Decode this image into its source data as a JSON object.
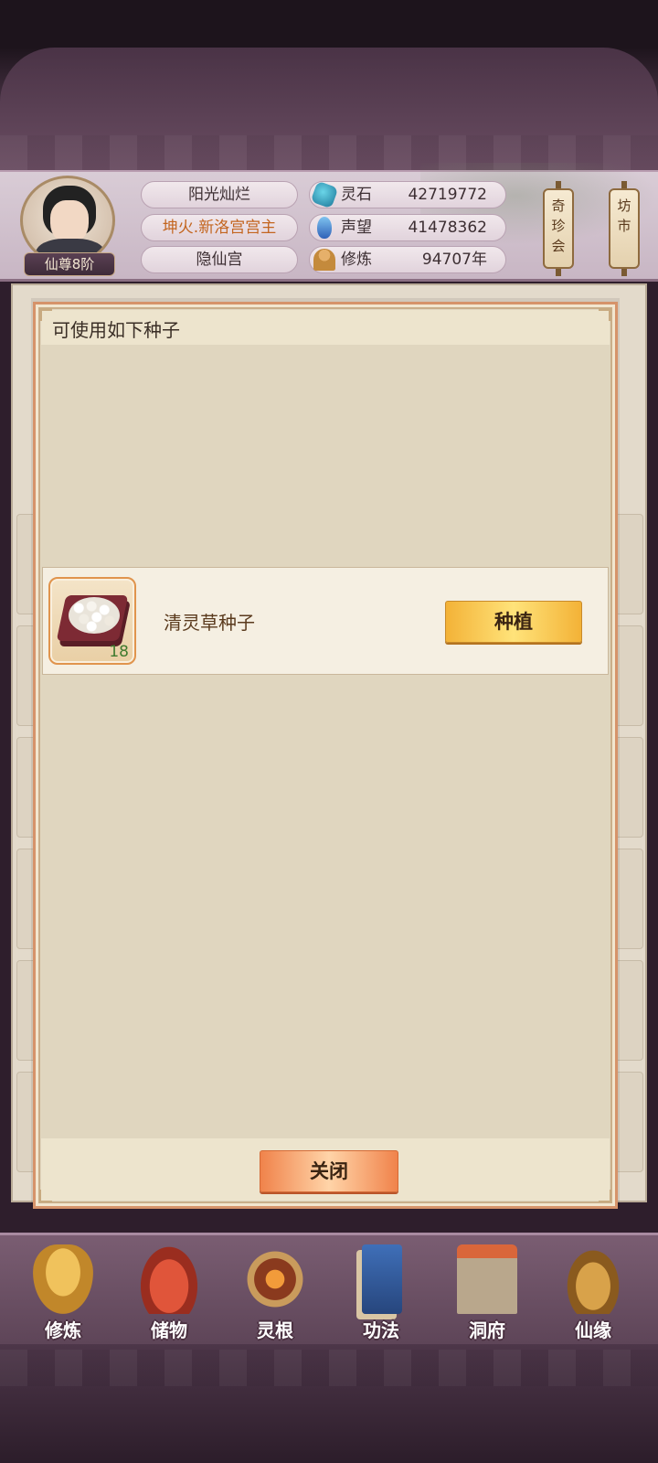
{
  "player": {
    "rank": "仙尊8阶",
    "name": "阳光灿烂",
    "title": "坤火.新洛宫宫主",
    "sect": "隐仙宫"
  },
  "stats": [
    {
      "icon": "spirit-stone-icon",
      "label": "灵石",
      "value": "42719772"
    },
    {
      "icon": "reputation-icon",
      "label": "声望",
      "value": "41478362"
    },
    {
      "icon": "cultivation-icon",
      "label": "修炼",
      "value": "94707年"
    }
  ],
  "side_buttons": {
    "qizhenhui": "奇珍会",
    "fangshi": "坊市"
  },
  "modal": {
    "title": "可使用如下种子",
    "items": [
      {
        "icon": "seed-tray-icon",
        "name": "清灵草种子",
        "count": "18",
        "action": "种植"
      }
    ],
    "close_label": "关闭"
  },
  "bottom_nav": [
    {
      "icon": "cultivate-icon",
      "label": "修炼"
    },
    {
      "icon": "storage-bag-icon",
      "label": "储物"
    },
    {
      "icon": "spirit-root-icon",
      "label": "灵根"
    },
    {
      "icon": "technique-book-icon",
      "label": "功法"
    },
    {
      "icon": "cave-mansion-icon",
      "label": "洞府"
    },
    {
      "icon": "immortal-fate-icon",
      "label": "仙缘"
    }
  ],
  "colors": {
    "accent_orange": "#c3651f",
    "plant_button": "#f3b237",
    "close_button": "#f0834b",
    "seed_count": "#3f7a2f"
  }
}
